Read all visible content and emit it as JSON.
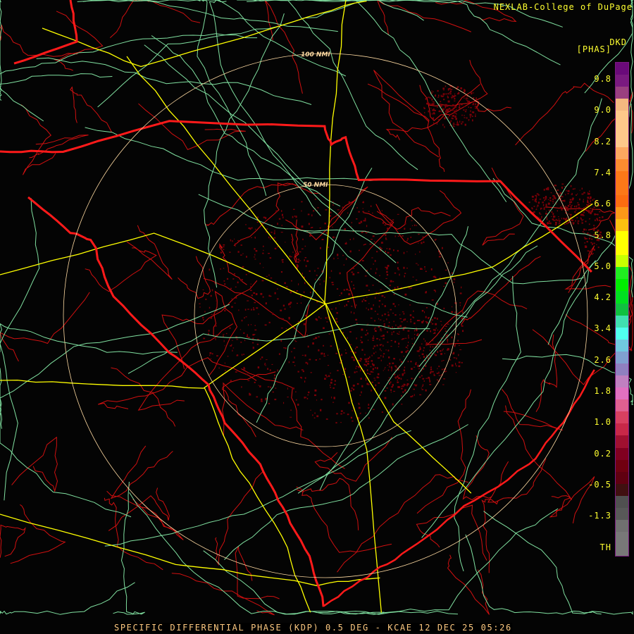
{
  "header": {
    "credit": "NEXLAB-College of DuPage",
    "site_id": "DKD",
    "units": "[PHAS]"
  },
  "range_rings": {
    "inner_label": "50 NMI",
    "outer_label": "100 NMI"
  },
  "legend": {
    "labels": [
      "9.8",
      "9.0",
      "8.2",
      "7.4",
      "6.6",
      "5.8",
      "5.0",
      "4.2",
      "3.4",
      "2.6",
      "1.8",
      "1.0",
      "0.2",
      "-0.5",
      "-1.3",
      "TH"
    ],
    "colors": [
      "#6a0a7a",
      "#7a1a80",
      "#9a4080",
      "#f4b880",
      "#fdc88a",
      "#fdc88a",
      "#fdc88a",
      "#fca860",
      "#fc8c30",
      "#fc7818",
      "#fc7818",
      "#fc6c10",
      "#fc9818",
      "#fcc010",
      "#ffff00",
      "#ffff00",
      "#c8ff00",
      "#20ee20",
      "#00ee00",
      "#00e020",
      "#10c040",
      "#40e0b0",
      "#50ffee",
      "#70c8e0",
      "#80a0d0",
      "#9080c0",
      "#c080c0",
      "#e070c0",
      "#e06090",
      "#d84060",
      "#c82848",
      "#a01030",
      "#800020",
      "#700010",
      "#600010",
      "#401010",
      "#505050",
      "#585858",
      "#707070",
      "#787878",
      "#787878"
    ]
  },
  "caption": "SPECIFIC DIFFERENTIAL PHASE (KDP) 0.5 DEG - KCAE 12 DEC 25 05:26",
  "colors": {
    "state_border": "#ff1a1a",
    "county": "#d01010",
    "highway": "#ffff00",
    "road": "#80e0a0",
    "range_ring": "#fcd8a0",
    "echo": "#7a0008"
  }
}
